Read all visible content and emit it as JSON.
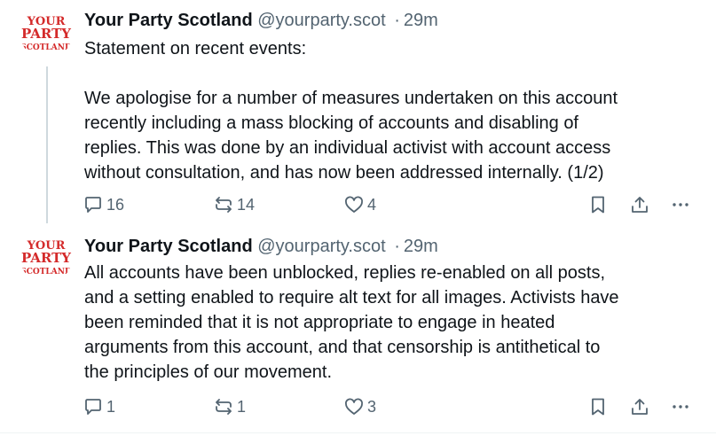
{
  "posts": [
    {
      "author_name": "Your Party Scotland",
      "handle": "@yourparty.scot",
      "separator": "·",
      "time": "29m",
      "avatar_text": [
        "YOUR",
        "PARTY",
        "SCOTLAND"
      ],
      "text": "Statement on recent events:\n\nWe apologise for a number of measures undertaken on this account\nrecently including a mass blocking of accounts and disabling of\nreplies. This was done by an individual activist with account access\nwithout consultation, and has now been addressed internally. (1/2)",
      "replies": "16",
      "reposts": "14",
      "likes": "4"
    },
    {
      "author_name": "Your Party Scotland",
      "handle": "@yourparty.scot",
      "separator": "·",
      "time": "29m",
      "avatar_text": [
        "YOUR",
        "PARTY",
        "SCOTLAND"
      ],
      "text": "All accounts have been unblocked, replies re-enabled on all posts,\nand a setting enabled to require alt text for all images. Activists have\nbeen reminded that it is not appropriate to engage in heated\narguments from this account, and that censorship is antithetical to\nthe principles of our movement.",
      "replies": "1",
      "reposts": "1",
      "likes": "3"
    }
  ],
  "icons": {
    "reply": "reply-icon",
    "repost": "repost-icon",
    "like": "heart-icon",
    "bookmark": "bookmark-icon",
    "share": "share-icon",
    "more": "more-icon"
  },
  "colors": {
    "brand_red": "#d42a2a",
    "muted": "#536471",
    "text": "#0f1419",
    "thread_line": "#cfd9de"
  }
}
